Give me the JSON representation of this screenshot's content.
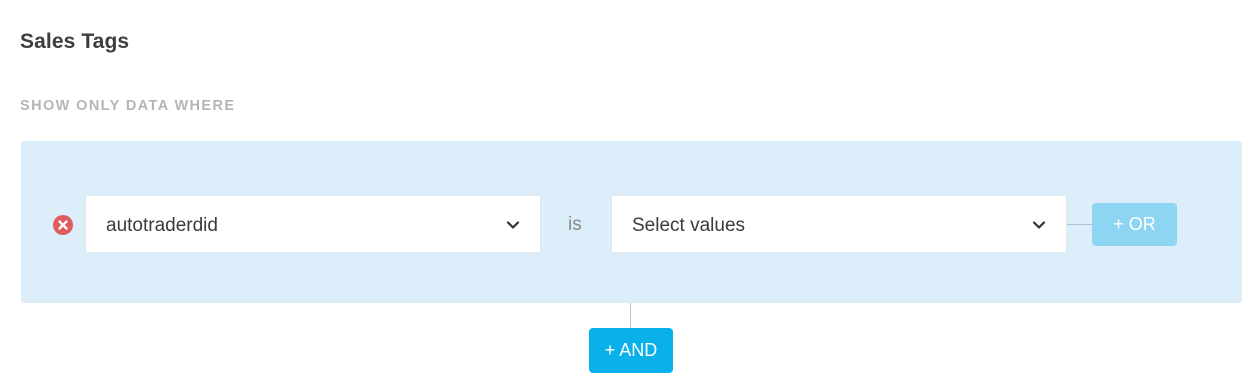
{
  "header": {
    "title": "Sales Tags"
  },
  "filter": {
    "section_label": "SHOW ONLY DATA WHERE",
    "conditions": [
      {
        "field": "autotraderdid",
        "operator": "is",
        "values_placeholder": "Select values"
      }
    ],
    "or_button_label": "+ OR",
    "and_button_label": "+ AND"
  },
  "colors": {
    "filter_background": "#dbeefa",
    "remove_icon": "#e05c5c",
    "or_button": "#8ed4f3",
    "and_button": "#0ab0ea"
  },
  "icons": {
    "remove": "close-circle-icon",
    "dropdown": "chevron-down-icon"
  }
}
